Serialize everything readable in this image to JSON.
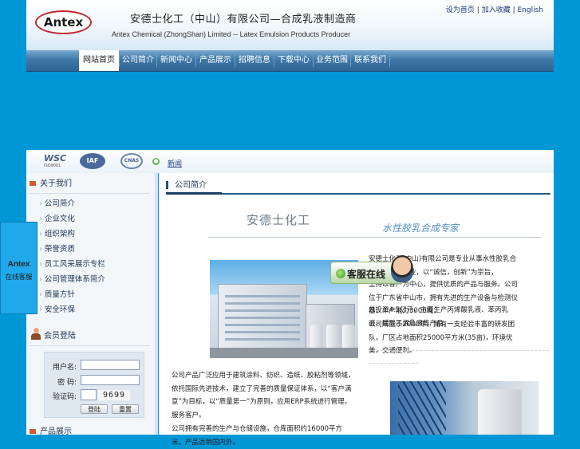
{
  "header": {
    "logo_text": "Antex",
    "title_cn": "安德士化工（中山）有限公司—合成乳液制造商",
    "title_en": "Antex Chemical (ZhongShan) Limited  --  Latex Emulsion Products Producer",
    "links": [
      "设为首页",
      "加入收藏",
      "English"
    ],
    "link_sep": "|"
  },
  "nav": {
    "items": [
      "网站首页",
      "公司简介",
      "新闻中心",
      "产品展示",
      "招聘信息",
      "下载中心",
      "业务范围",
      "联系我们"
    ],
    "active_index": 0
  },
  "certs": {
    "wsc": "WSC",
    "wsc_sub": "ISO9001",
    "iaf": "IAF",
    "cnas": "CNAS",
    "link_icon": "green-dot-icon",
    "link_text": "新闻"
  },
  "sidebar": {
    "section1_title": "关于我们",
    "items": [
      "公司简介",
      "企业文化",
      "组织架构",
      "荣誉资质",
      "员工风采展示专栏",
      "公司管理体系简介",
      "质量方针",
      "安全环保"
    ],
    "member_title": "会员登陆",
    "login": {
      "user_label": "用户名:",
      "pass_label": "密  码:",
      "code_label": "验证码:",
      "captcha": "9699",
      "login_btn": "登陆",
      "reset_btn": "重置"
    },
    "section3_title": "产品展示"
  },
  "main": {
    "heading": "公司简介",
    "banner_cn": "安德士化工",
    "banner_slogan": "水性胶乳合成专家",
    "para_right": [
      "安德士化工(中山)有限公司是专业从事水性胶乳合成与研发的企业，以“诚信，创新”为宗旨，",
      "坚持以客户为中心，提供优质的产品与服务。公司位于广东省中山市，拥有先进的生产设备与检测仪器，年产能力3000吨，",
      "总投资4.5亿元，主要生产丙烯酸乳液、苯丙乳液、醋酸乙烯乳液等产品。",
      "公司成立于2000年，拥有一支经验丰富的研发团队，厂区占地面积25000平方米(35亩)，环境优美，交通便利。"
    ],
    "para_bottom": [
      "公司产品广泛应用于建筑涂料、纺织、造纸、胶粘剂等领域，依托国际先进技术，建立了完善的质量保证体系，以“客户满意”为目标，以“质量第一”为原则，应用ERP系统进行管理，服务客户。",
      "公司拥有完善的生产与仓储设施，仓库面积约16000平方米，产品远销国内外。"
    ]
  },
  "float_tab": {
    "brand": "Antex",
    "sub": "在线客服"
  },
  "kefu": {
    "label": "客服在线"
  }
}
